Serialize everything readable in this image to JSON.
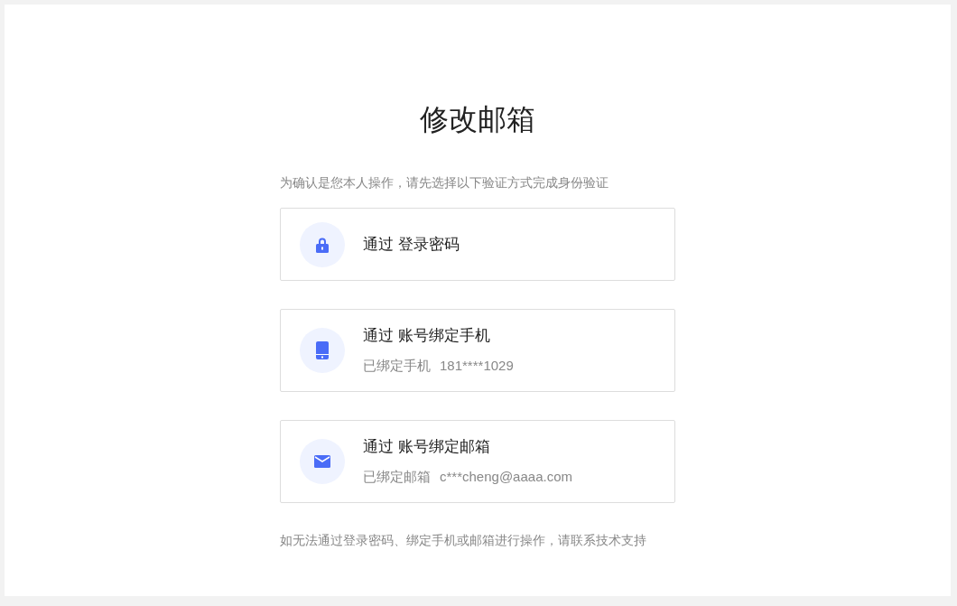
{
  "title": "修改邮箱",
  "instruction": "为确认是您本人操作，请先选择以下验证方式完成身份验证",
  "options": [
    {
      "kind": "lock",
      "label": "通过 登录密码"
    },
    {
      "kind": "phone",
      "label": "通过 账号绑定手机",
      "detail_label": "已绑定手机",
      "detail_value": "181****1029"
    },
    {
      "kind": "mail",
      "label": "通过 账号绑定邮箱",
      "detail_label": "已绑定邮箱",
      "detail_value": "c***cheng@aaaa.com"
    }
  ],
  "footer_note": "如无法通过登录密码、绑定手机或邮箱进行操作，请联系技术支持"
}
